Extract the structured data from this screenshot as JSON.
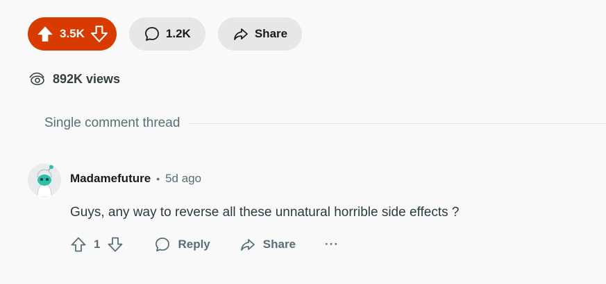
{
  "post_actions": {
    "vote_count": "3.5K",
    "comment_count": "1.2K",
    "share_label": "Share",
    "upvote_icon": "upvote-icon",
    "downvote_icon": "downvote-icon",
    "comment_icon": "comment-icon",
    "share_icon": "share-icon",
    "accent_color": "#d93a00"
  },
  "views": {
    "text": "892K views",
    "icon": "eye-icon"
  },
  "thread": {
    "label": "Single comment thread"
  },
  "comment": {
    "author": "Madamefuture",
    "separator": "•",
    "time": "5d ago",
    "body": "Guys, any way to reverse all these unnatural horrible side effects ?",
    "score": "1",
    "reply_label": "Reply",
    "share_label": "Share",
    "more_label": "···"
  }
}
